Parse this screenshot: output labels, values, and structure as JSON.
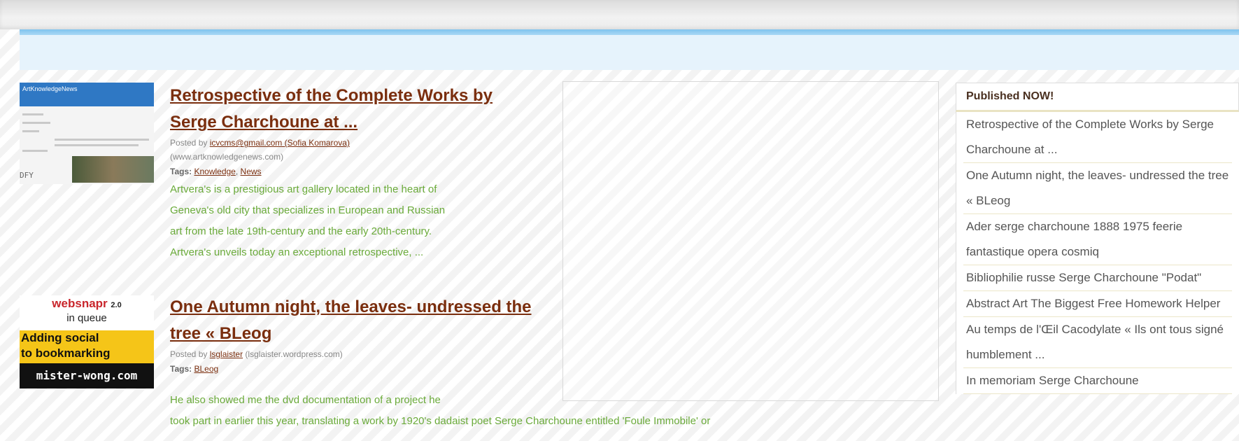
{
  "posts": [
    {
      "title": "Retrospective of the Complete Works by Serge Charchoune at ...",
      "title_lines": [
        "Retrospective of the Complete Works by",
        "Serge Charchoune at ..."
      ],
      "posted_by_label": "Posted by",
      "author": "icvcms@gmail.com (Sofia Komarova)",
      "source": "(www.artknowledgenews.com)",
      "tags_label": "Tags:",
      "tags": [
        "Knowledge",
        "News"
      ],
      "excerpt_lines": [
        "Artvera's is a prestigious art gallery located in the heart of",
        "Geneva's old city that specializes in European and Russian",
        "art from the late 19th-century and the early 20th-century.",
        "Artvera's unveils today an exceptional retrospective, ..."
      ]
    },
    {
      "title": "One Autumn night, the leaves- undressed the tree « BLeog",
      "title_lines": [
        "One Autumn night, the leaves- undressed the",
        "tree « BLeog"
      ],
      "posted_by_label": "Posted by",
      "author": "lsglaister",
      "source": "(lsglaister.wordpress.com)",
      "tags_label": "Tags:",
      "tags": [
        "BLeog"
      ],
      "excerpt_lines": [
        "He also showed me the dvd documentation of a project he",
        "took part in earlier this year, translating a work by 1920's dadaist poet Serge Charchoune entitled 'Foule Immobile' or"
      ]
    }
  ],
  "thumbnails": {
    "first": {
      "header_text": "ArtKnowledgeNews",
      "footer_text": "DFY"
    },
    "second": {
      "brand": "websnapr",
      "version": "2.0",
      "status": "in queue",
      "message_lines": [
        "Adding social",
        "to bookmarking"
      ],
      "site": "mister-wong.com"
    }
  },
  "sidebar": {
    "header": "Published NOW!",
    "items": [
      "Retrospective of the Complete Works by Serge Charchoune at ...",
      "One Autumn night, the leaves- undressed the tree « BLeog",
      "Ader serge charchoune 1888 1975 feerie fantastique opera cosmiq",
      "Bibliophilie russe Serge Charchoune \"Podat\"",
      "Abstract Art The Biggest Free Homework Helper",
      "Au temps de l'Œil Cacodylate « Ils ont tous signé humblement ...",
      "In memoriam Serge Charchoune"
    ]
  },
  "colors": {
    "link": "#7a2e0e",
    "excerpt": "#6aaa3a",
    "blue_bar": "#e6f3fc",
    "blue_line": "#7fc3ee"
  }
}
